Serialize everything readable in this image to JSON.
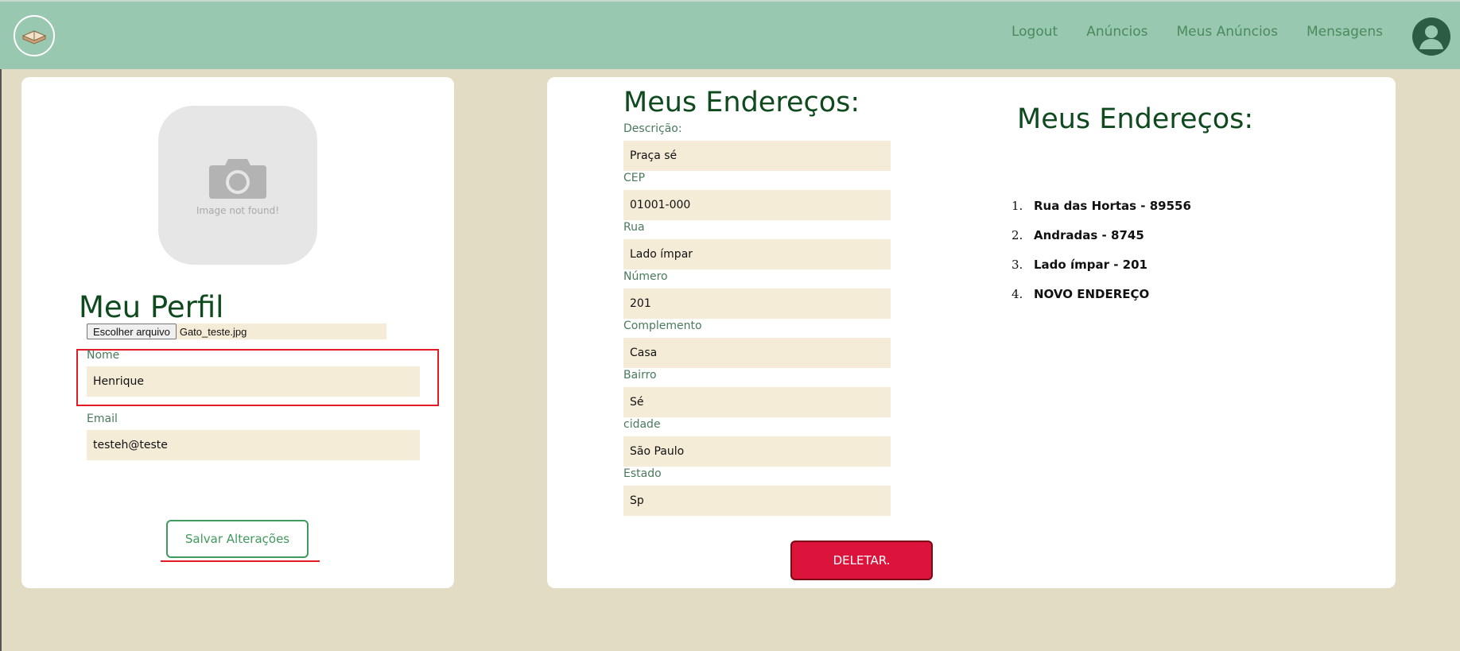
{
  "nav": {
    "links": [
      "Logout",
      "Anúncios",
      "Meus Anúncios",
      "Mensagens"
    ]
  },
  "profile": {
    "photo_caption": "Image not found!",
    "title": "Meu Perfil",
    "file_button": "Escolher arquivo",
    "file_name": "Gato_teste.jpg",
    "name_label": "Nome",
    "name_value": "Henrique",
    "email_label": "Email",
    "email_value": "testeh@teste",
    "save_label": "Salvar Alterações"
  },
  "address_form": {
    "title": "Meus Endereços:",
    "fields": [
      {
        "label": "Descrição:",
        "value": "Praça sé"
      },
      {
        "label": "CEP",
        "value": "01001-000"
      },
      {
        "label": "Rua",
        "value": "Lado ímpar"
      },
      {
        "label": "Número",
        "value": "201"
      },
      {
        "label": "Complemento",
        "value": "Casa"
      },
      {
        "label": "Bairro",
        "value": "Sé"
      },
      {
        "label": "cidade",
        "value": "São Paulo"
      },
      {
        "label": "Estado",
        "value": "Sp"
      }
    ],
    "delete_label": "DELETAR."
  },
  "address_list": {
    "title": "Meus Endereços:",
    "items": [
      {
        "num": "1.",
        "text": "Rua das Hortas - 89556"
      },
      {
        "num": "2.",
        "text": "Andradas - 8745"
      },
      {
        "num": "3.",
        "text": "Lado ímpar - 201"
      },
      {
        "num": "4.",
        "text": "NOVO ENDEREÇO"
      }
    ]
  },
  "colors": {
    "navbar": "#99c8b1",
    "background": "#e2dcc5",
    "title_green": "#0e4a1e",
    "input_bg": "#f5ecd8",
    "delete_red": "#dc143c",
    "highlight_red": "#e01b24"
  },
  "icons": [
    "book-logo-icon",
    "camera-icon",
    "user-avatar-icon"
  ]
}
